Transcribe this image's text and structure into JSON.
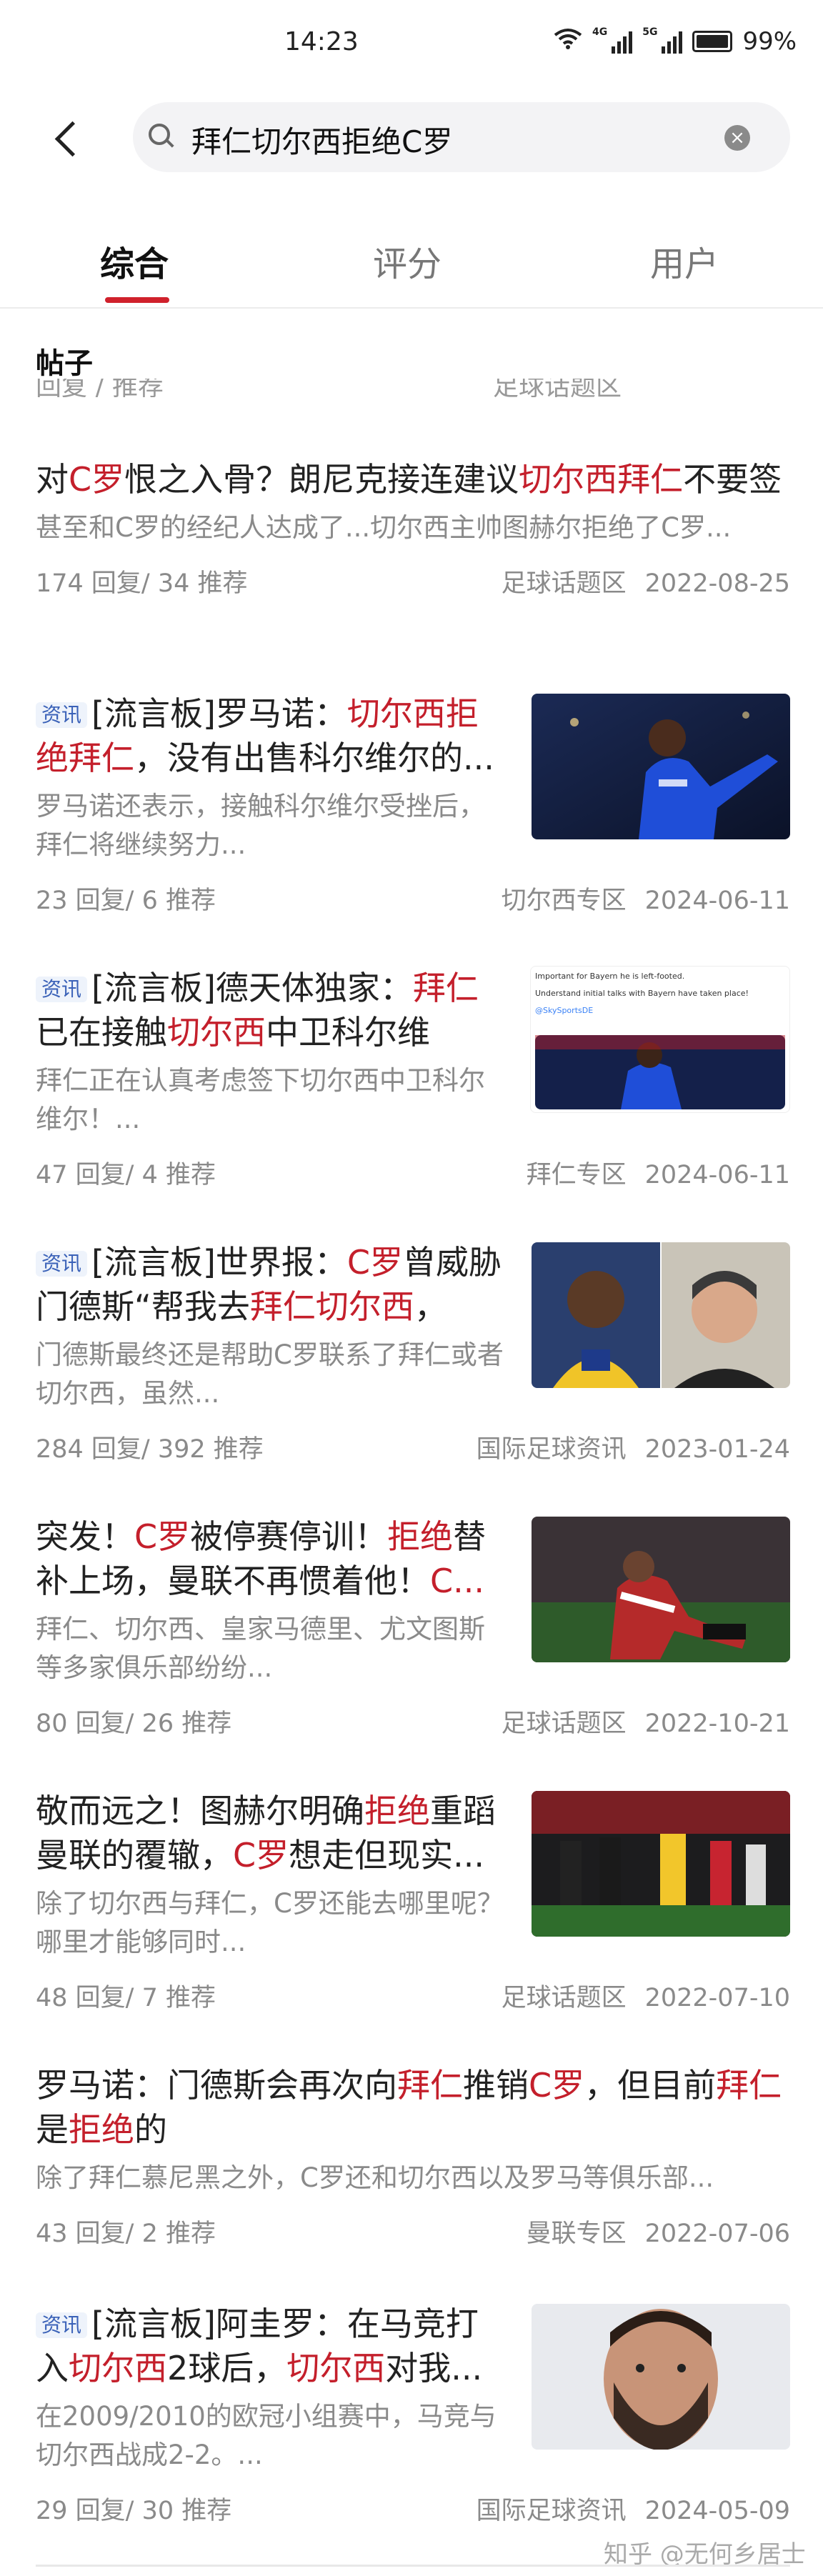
{
  "status": {
    "time": "14:23",
    "network_a": "4G",
    "network_b": "5G",
    "battery": "99%"
  },
  "search": {
    "query": "拜仁切尔西拒绝C罗"
  },
  "tabs": [
    "综合",
    "评分",
    "用户"
  ],
  "section_title": "帖子",
  "cut_remnant": [
    "回复 / 推荐",
    "足球话题区"
  ],
  "posts": [
    {
      "title": [
        "对",
        {
          "hl": "C罗"
        },
        "恨之入骨？朗尼克接连建议",
        {
          "hl": "切尔西拜仁"
        },
        "不要签"
      ],
      "snippet": "甚至和C罗的经纪人达成了...切尔西主帅图赫尔拒绝了C罗...",
      "stats": "174 回复/ 34 推荐",
      "board": "足球话题区",
      "date": "2022-08-25"
    },
    {
      "badge": "资讯",
      "title": [
        "[流言板]罗马诺：",
        {
          "hl": "切尔西拒绝拜仁"
        },
        "，没有出售科尔维尔的..."
      ],
      "snippet": "罗马诺还表示，接触科尔维尔受挫后，拜仁将继续努力...",
      "stats": "23 回复/ 6 推荐",
      "board": "切尔西专区",
      "date": "2024-06-11",
      "image": "blue-jersey-player-photo"
    },
    {
      "badge": "资讯",
      "title": [
        "[流言板]德天体独家：",
        {
          "hl": "拜仁"
        },
        "已在接触",
        {
          "hl": "切尔西"
        },
        "中卫科尔维尔，..."
      ],
      "snippet": "拜仁正在认真考虑签下切尔西中卫科尔维尔！...",
      "stats": "47 回复/ 4 推荐",
      "board": "拜仁专区",
      "date": "2024-06-11",
      "image": "tweet-screenshot-photo",
      "image_text": [
        "Important for Bayern he is left-footed.",
        "Understand initial talks with Bayern have taken place!",
        "@SkySportsDE"
      ]
    },
    {
      "badge": "资讯",
      "title": [
        "[流言板]世界报：",
        {
          "hl": "C罗"
        },
        "曾威胁门德斯“帮我去",
        {
          "hl": "拜仁切尔西"
        },
        "，否..."
      ],
      "snippet": "门德斯最终还是帮助C罗联系了拜仁或者切尔西，虽然...",
      "stats": "284 回复/ 392 推荐",
      "board": "国际足球资讯",
      "date": "2023-01-24",
      "image": "two-men-portrait-photo"
    },
    {
      "title": [
        "突发！",
        {
          "hl": "C罗"
        },
        "被停赛停训！",
        {
          "hl": "拒绝"
        },
        "替补上场，曼联不再惯着他！",
        {
          "hl": "C..."
        }
      ],
      "snippet": "拜仁、切尔西、皇家马德里、尤文图斯等多家俱乐部纷纷...",
      "stats": "80 回复/ 26 推荐",
      "board": "足球话题区",
      "date": "2022-10-21",
      "image": "manchester-player-photo"
    },
    {
      "title": [
        "敬而远之！图赫尔明确",
        {
          "hl": "拒绝"
        },
        "重蹈曼联的覆辙，",
        {
          "hl": "C罗"
        },
        "想走但现实..."
      ],
      "snippet": "除了切尔西与拜仁，C罗还能去哪里呢？哪里才能够同时...",
      "stats": "48 回复/ 7 推荐",
      "board": "足球话题区",
      "date": "2022-07-10",
      "image": "dugout-photo"
    },
    {
      "title": [
        "罗马诺：门德斯会再次向",
        {
          "hl": "拜仁"
        },
        "推销",
        {
          "hl": "C罗"
        },
        "，但目前",
        {
          "hl": "拜仁"
        },
        "是",
        {
          "hl": "拒绝"
        },
        "的"
      ],
      "snippet": "除了拜仁慕尼黑之外，C罗还和切尔西以及罗马等俱乐部...",
      "stats": "43 回复/ 2 推荐",
      "board": "曼联专区",
      "date": "2022-07-06"
    },
    {
      "badge": "资讯",
      "title": [
        "[流言板]阿圭罗：在马竞打入",
        {
          "hl": "切尔西"
        },
        "2球后，",
        {
          "hl": "切尔西"
        },
        "对我..."
      ],
      "snippet": "在2009/2010的欧冠小组赛中，马竞与切尔西战成2-2。...",
      "stats": "29 回复/ 30 推荐",
      "board": "国际足球资讯",
      "date": "2024-05-09",
      "image": "bearded-man-portrait-photo"
    }
  ],
  "watermark": "知乎 @无何乡居士"
}
